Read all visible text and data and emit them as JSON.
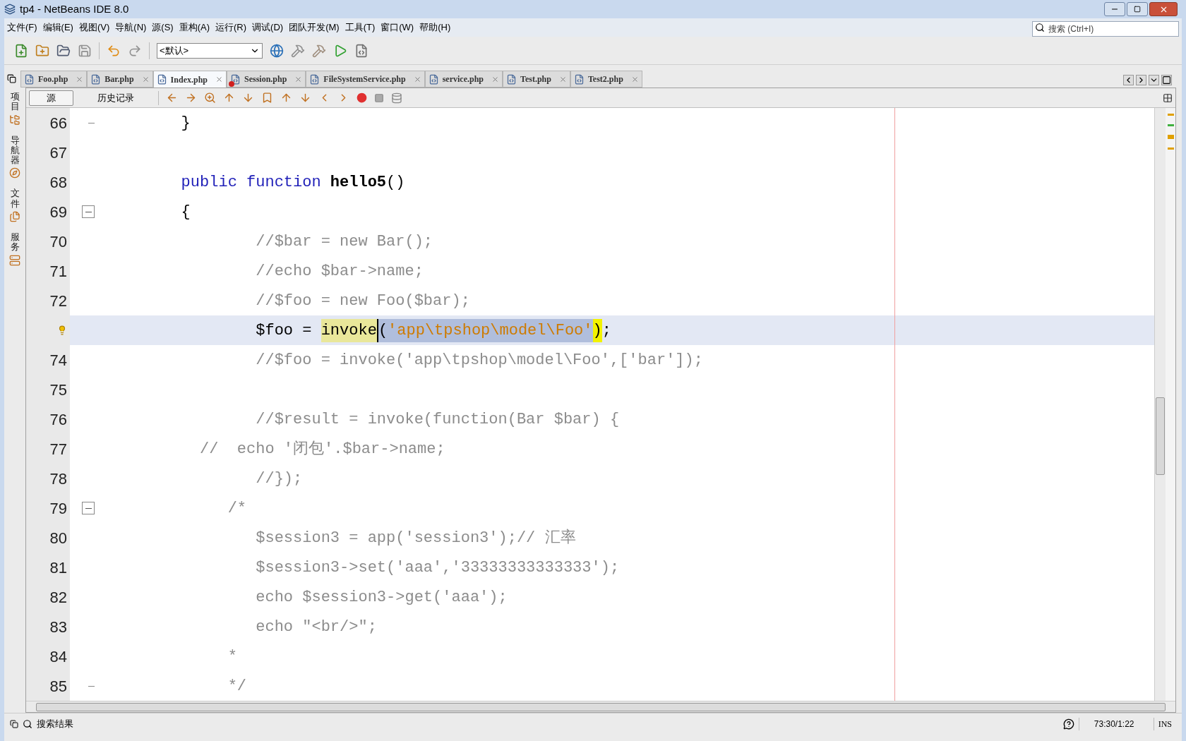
{
  "window": {
    "title": "tp4 - NetBeans IDE 8.0"
  },
  "menu": [
    "文件(F)",
    "编辑(E)",
    "视图(V)",
    "导航(N)",
    "源(S)",
    "重构(A)",
    "运行(R)",
    "调试(D)",
    "团队开发(M)",
    "工具(T)",
    "窗口(W)",
    "帮助(H)"
  ],
  "search": {
    "placeholder": "搜索 (Ctrl+I)"
  },
  "toolbar": {
    "configuration": "<默认>"
  },
  "tabs": [
    {
      "label": "Foo.php",
      "selected": false,
      "error": false
    },
    {
      "label": "Bar.php",
      "selected": false,
      "error": false
    },
    {
      "label": "Index.php",
      "selected": true,
      "error": false
    },
    {
      "label": "Session.php",
      "selected": false,
      "error": true
    },
    {
      "label": "FileSystemService.php",
      "selected": false,
      "error": false
    },
    {
      "label": "service.php",
      "selected": false,
      "error": false
    },
    {
      "label": "Test.php",
      "selected": false,
      "error": false
    },
    {
      "label": "Test2.php",
      "selected": false,
      "error": false
    }
  ],
  "side_panels": [
    "项目",
    "导航器",
    "文件",
    "服务"
  ],
  "editor_tabs": [
    {
      "label": "源",
      "selected": true
    },
    {
      "label": "历史记录",
      "selected": false
    }
  ],
  "editor": {
    "lines": [
      {
        "number": "66",
        "fold_start": false,
        "fold_end": true,
        "hint": false,
        "current": false,
        "tokens": [
          {
            "kind": "plain",
            "text": "        }"
          }
        ]
      },
      {
        "number": "67",
        "fold_start": false,
        "fold_end": false,
        "hint": false,
        "current": false
      },
      {
        "number": "68",
        "fold_start": false,
        "fold_end": false,
        "hint": false,
        "current": false,
        "tokens": [
          {
            "kind": "keyword",
            "text": "        public function "
          },
          {
            "kind": "function-name",
            "text": "hello5"
          },
          {
            "kind": "plain",
            "text": "()"
          }
        ]
      },
      {
        "number": "69",
        "fold_start": true,
        "fold_end": false,
        "hint": false,
        "current": false,
        "tokens": [
          {
            "kind": "plain",
            "text": "        {"
          }
        ]
      },
      {
        "number": "70",
        "fold_start": false,
        "fold_end": false,
        "hint": false,
        "current": false,
        "tokens": [
          {
            "kind": "comment",
            "text": "                //$bar = new Bar();"
          }
        ]
      },
      {
        "number": "71",
        "fold_start": false,
        "fold_end": false,
        "hint": false,
        "current": false,
        "tokens": [
          {
            "kind": "comment",
            "text": "                //echo $bar->name;"
          }
        ]
      },
      {
        "number": "72",
        "fold_start": false,
        "fold_end": false,
        "hint": false,
        "current": false,
        "tokens": [
          {
            "kind": "comment",
            "text": "                //$foo = new Foo($bar);"
          }
        ]
      },
      {
        "fold_start": false,
        "fold_end": false,
        "hint": true,
        "current": true,
        "tokens": [
          {
            "kind": "plain",
            "text": "                $foo = "
          },
          {
            "kind": "occurrence",
            "text": "invoke"
          },
          {
            "kind": "selected",
            "text": "("
          },
          {
            "kind": "selected-string",
            "text": "'app\\tpshop\\model\\Foo'"
          },
          {
            "kind": "bracket-match",
            "text": ")"
          },
          {
            "kind": "plain",
            "text": ";"
          }
        ]
      },
      {
        "number": "74",
        "fold_start": false,
        "fold_end": false,
        "hint": false,
        "current": false,
        "tokens": [
          {
            "kind": "comment",
            "text": "                //$foo = invoke('app\\tpshop\\model\\Foo',['bar']);"
          }
        ]
      },
      {
        "number": "75",
        "fold_start": false,
        "fold_end": false,
        "hint": false,
        "current": false
      },
      {
        "number": "76",
        "fold_start": false,
        "fold_end": false,
        "hint": false,
        "current": false,
        "tokens": [
          {
            "kind": "comment",
            "text": "                //$result = invoke(function(Bar $bar) {"
          }
        ]
      },
      {
        "number": "77",
        "fold_start": false,
        "fold_end": false,
        "hint": false,
        "current": false,
        "tokens": [
          {
            "kind": "comment",
            "text": "          //  echo '闭包'.$bar->name;"
          }
        ]
      },
      {
        "number": "78",
        "fold_start": false,
        "fold_end": false,
        "hint": false,
        "current": false,
        "tokens": [
          {
            "kind": "comment",
            "text": "                //});"
          }
        ]
      },
      {
        "number": "79",
        "fold_start": true,
        "fold_end": false,
        "hint": false,
        "current": false,
        "tokens": [
          {
            "kind": "comment",
            "text": "             /*"
          }
        ]
      },
      {
        "number": "80",
        "fold_start": false,
        "fold_end": false,
        "hint": false,
        "current": false,
        "tokens": [
          {
            "kind": "comment",
            "text": "                $session3 = app('session3');// 汇率"
          }
        ]
      },
      {
        "number": "81",
        "fold_start": false,
        "fold_end": false,
        "hint": false,
        "current": false,
        "tokens": [
          {
            "kind": "comment",
            "text": "                $session3->set('aaa','33333333333333');"
          }
        ]
      },
      {
        "number": "82",
        "fold_start": false,
        "fold_end": false,
        "hint": false,
        "current": false,
        "tokens": [
          {
            "kind": "comment",
            "text": "                echo $session3->get('aaa');"
          }
        ]
      },
      {
        "number": "83",
        "fold_start": false,
        "fold_end": false,
        "hint": false,
        "current": false,
        "tokens": [
          {
            "kind": "comment",
            "text": "                echo \"<br/>\";"
          }
        ]
      },
      {
        "number": "84",
        "fold_start": false,
        "fold_end": false,
        "hint": false,
        "current": false,
        "tokens": [
          {
            "kind": "comment",
            "text": "             *"
          }
        ]
      },
      {
        "number": "85",
        "fold_start": false,
        "fold_end": true,
        "hint": false,
        "current": false,
        "tokens": [
          {
            "kind": "comment",
            "text": "             */"
          }
        ]
      }
    ]
  },
  "status_bar": {
    "output_tab": "搜索结果",
    "position": "73:30/1:22",
    "mode": "INS"
  }
}
